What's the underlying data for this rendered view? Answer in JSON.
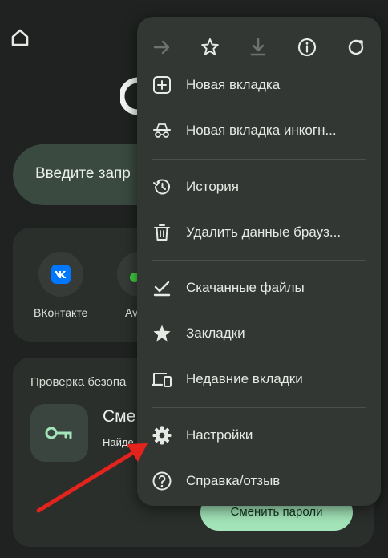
{
  "background": {
    "search_placeholder": "Введите запр",
    "shortcuts": [
      {
        "label": "ВКонтакте",
        "icon": "vk-icon"
      },
      {
        "label": "Av",
        "icon": "avito-icon"
      }
    ],
    "safety_check": {
      "title": "Проверка безопа",
      "heading": "Сме",
      "subtitle": "Найде",
      "button": "Сменить пароли"
    }
  },
  "menu": {
    "top_actions": [
      {
        "name": "forward-icon"
      },
      {
        "name": "bookmark-star-icon"
      },
      {
        "name": "download-icon"
      },
      {
        "name": "page-info-icon"
      },
      {
        "name": "reload-icon"
      }
    ],
    "items": [
      {
        "label": "Новая вкладка",
        "icon": "new-tab-icon"
      },
      {
        "label": "Новая вкладка инкогн...",
        "icon": "incognito-icon"
      },
      {
        "label": "История",
        "icon": "history-icon"
      },
      {
        "label": "Удалить данные брауз...",
        "icon": "trash-icon"
      },
      {
        "label": "Скачанные файлы",
        "icon": "downloads-check-icon"
      },
      {
        "label": "Закладки",
        "icon": "star-icon"
      },
      {
        "label": "Недавние вкладки",
        "icon": "devices-icon"
      },
      {
        "label": "Настройки",
        "icon": "gear-icon"
      },
      {
        "label": "Справка/отзыв",
        "icon": "help-icon"
      }
    ]
  },
  "colors": {
    "background": "#1f2220",
    "menu": "#323734",
    "accent_green": "#a3e4b8",
    "annotation_red": "#e5231d"
  }
}
